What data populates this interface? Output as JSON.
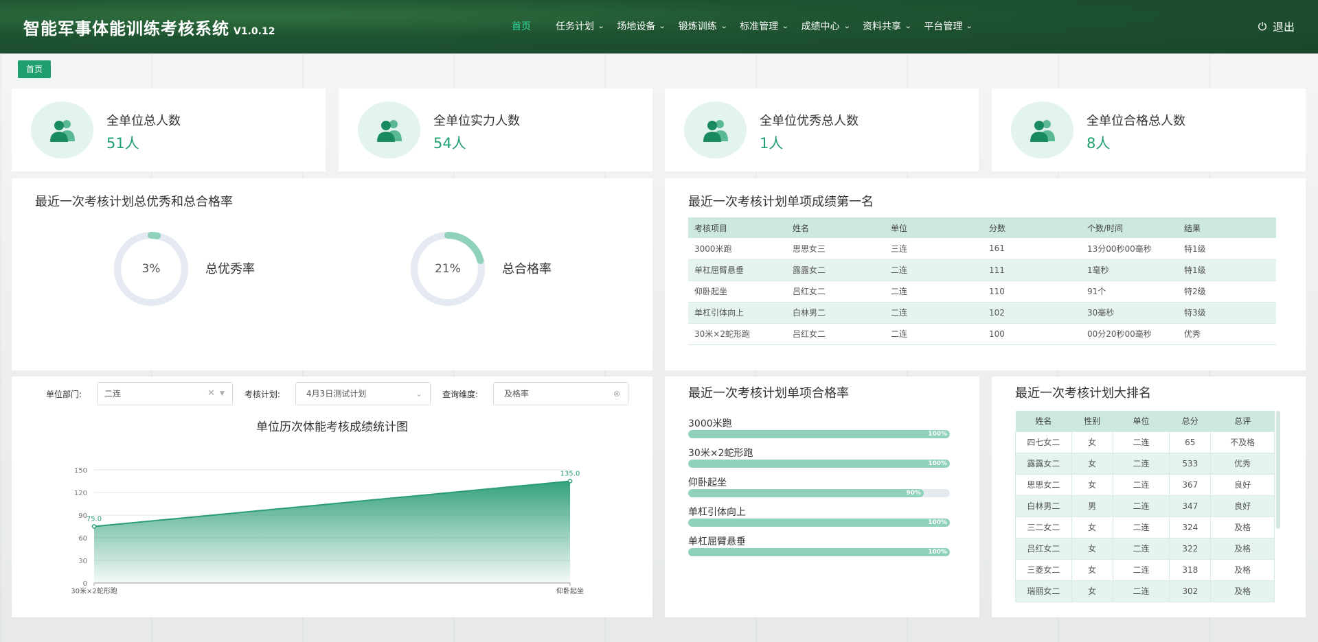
{
  "header": {
    "title": "智能军事体能训练考核系统",
    "version": "V1.0.12",
    "nav": [
      {
        "label": "首页",
        "active": true,
        "dropdown": false
      },
      {
        "label": "任务计划",
        "active": false,
        "dropdown": true
      },
      {
        "label": "场地设备",
        "active": false,
        "dropdown": true
      },
      {
        "label": "锻炼训练",
        "active": false,
        "dropdown": true
      },
      {
        "label": "标准管理",
        "active": false,
        "dropdown": true
      },
      {
        "label": "成绩中心",
        "active": false,
        "dropdown": true
      },
      {
        "label": "资料共享",
        "active": false,
        "dropdown": true
      },
      {
        "label": "平台管理",
        "active": false,
        "dropdown": true
      }
    ],
    "logout": "退出",
    "accent": "#2fd7a1"
  },
  "breadcrumb": "首页",
  "stats": [
    {
      "label": "全单位总人数",
      "value": "51人",
      "icon": "users-icon"
    },
    {
      "label": "全单位实力人数",
      "value": "54人",
      "icon": "users-icon"
    },
    {
      "label": "全单位优秀总人数",
      "value": "1人",
      "icon": "users-icon"
    },
    {
      "label": "全单位合格总人数",
      "value": "8人",
      "icon": "users-icon"
    }
  ],
  "rates": {
    "title": "最近一次考核计划总优秀和总合格率",
    "excellent": {
      "text": "3%",
      "value": 3,
      "label": "总优秀率"
    },
    "pass": {
      "text": "21%",
      "value": 21,
      "label": "总合格率"
    }
  },
  "top_scores": {
    "title": "最近一次考核计划单项成绩第一名",
    "columns": [
      "考核项目",
      "姓名",
      "单位",
      "分数",
      "个数/时间",
      "结果"
    ],
    "rows": [
      [
        "3000米跑",
        "思思女三",
        "三连",
        "161",
        "13分00秒00毫秒",
        "特1级"
      ],
      [
        "单杠屈臂悬垂",
        "露露女二",
        "二连",
        "111",
        "1毫秒",
        "特1级"
      ],
      [
        "仰卧起坐",
        "吕红女二",
        "二连",
        "110",
        "91个",
        "特2级"
      ],
      [
        "单杠引体向上",
        "白林男二",
        "二连",
        "102",
        "30毫秒",
        "特3级"
      ],
      [
        "30米×2蛇形跑",
        "吕红女二",
        "二连",
        "100",
        "00分20秒00毫秒",
        "优秀"
      ]
    ]
  },
  "filters": {
    "dept_label": "单位部门:",
    "dept_value": "二连",
    "plan_label": "考核计划:",
    "plan_value": "4月3日测试计划",
    "dim_label": "查询维度:",
    "dim_value": "及格率"
  },
  "chart_data": {
    "type": "area",
    "title": "单位历次体能考核成绩统计图",
    "categories": [
      "30米×2蛇形跑",
      "仰卧起坐"
    ],
    "values": [
      75.0,
      135.0
    ],
    "value_labels": [
      "75.0",
      "135.0"
    ],
    "ylim": [
      0,
      150
    ],
    "yticks": [
      "0",
      "30",
      "60",
      "90",
      "120",
      "150"
    ],
    "grid": true,
    "color": "#2a9d74"
  },
  "pass_rates": {
    "title": "最近一次考核计划单项合格率",
    "items": [
      {
        "name": "3000米跑",
        "pct_text": "100%",
        "value": 100
      },
      {
        "name": "30米×2蛇形跑",
        "pct_text": "100%",
        "value": 100
      },
      {
        "name": "仰卧起坐",
        "pct_text": "90%",
        "value": 90
      },
      {
        "name": "单杠引体向上",
        "pct_text": "100%",
        "value": 100
      },
      {
        "name": "单杠屈臂悬垂",
        "pct_text": "100%",
        "value": 100
      }
    ]
  },
  "ranking": {
    "title": "最近一次考核计划大排名",
    "columns": [
      "姓名",
      "性别",
      "单位",
      "总分",
      "总评"
    ],
    "rows": [
      [
        "四七女二",
        "女",
        "二连",
        "65",
        "不及格"
      ],
      [
        "露露女二",
        "女",
        "二连",
        "533",
        "优秀"
      ],
      [
        "思思女二",
        "女",
        "二连",
        "367",
        "良好"
      ],
      [
        "白林男二",
        "男",
        "二连",
        "347",
        "良好"
      ],
      [
        "三二女二",
        "女",
        "二连",
        "324",
        "及格"
      ],
      [
        "吕红女二",
        "女",
        "二连",
        "322",
        "及格"
      ],
      [
        "三菱女二",
        "女",
        "二连",
        "318",
        "及格"
      ],
      [
        "瑞丽女二",
        "女",
        "二连",
        "302",
        "及格"
      ]
    ]
  }
}
